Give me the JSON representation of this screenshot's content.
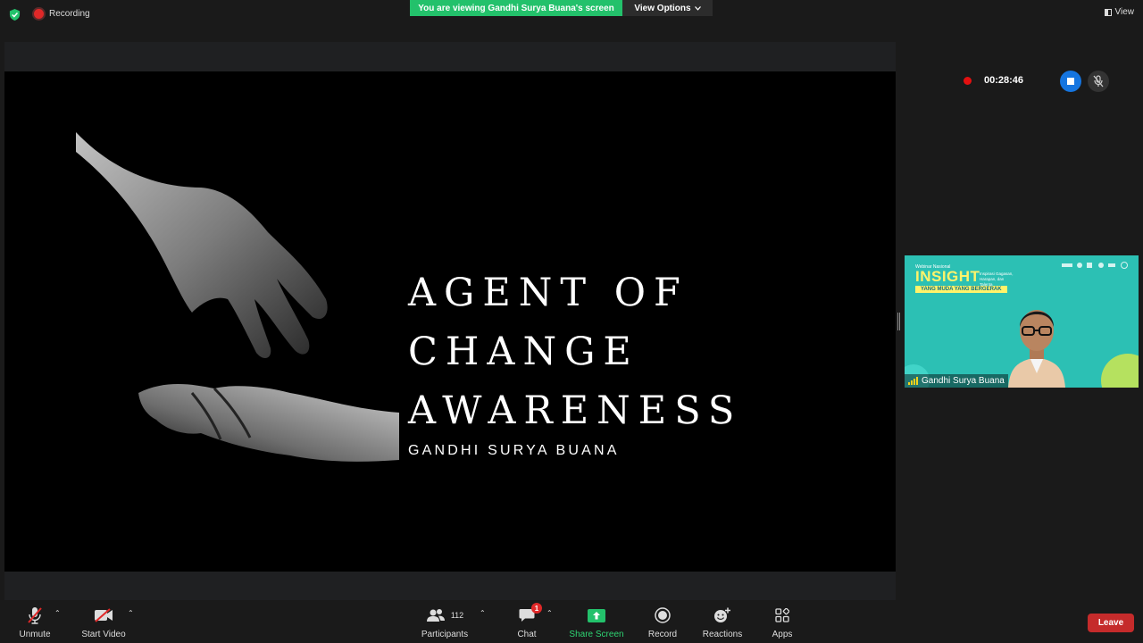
{
  "top": {
    "recording_label": "Recording",
    "viewing_banner": "You are viewing Gandhi Surya Buana's screen",
    "view_options_label": "View Options",
    "view_label": "View"
  },
  "slide": {
    "title_lines": [
      "AGENT OF",
      "CHANGE",
      "AWARENESS"
    ],
    "subtitle": "GANDHI SURYA BUANA"
  },
  "recording_panel": {
    "elapsed": "00:28:46"
  },
  "thumbnail": {
    "webinar_small": "Webinar Nasional",
    "insight": "INSIGHT",
    "insight_sub": "Inspirasi Gagasan, Harapan, dan Talenta",
    "tagline": "YANG MUDA YANG BERGERAK",
    "participant_name": "Gandhi Surya Buana"
  },
  "toolbar": {
    "unmute": "Unmute",
    "start_video": "Start Video",
    "participants": "Participants",
    "participants_count": "112",
    "chat": "Chat",
    "chat_badge": "1",
    "share_screen": "Share Screen",
    "record": "Record",
    "reactions": "Reactions",
    "apps": "Apps",
    "leave": "Leave"
  },
  "colors": {
    "share_green": "#23c16b",
    "leave_red": "#c52b2b",
    "record_blue": "#1575e0",
    "thumb_teal": "#2ec4b6"
  }
}
